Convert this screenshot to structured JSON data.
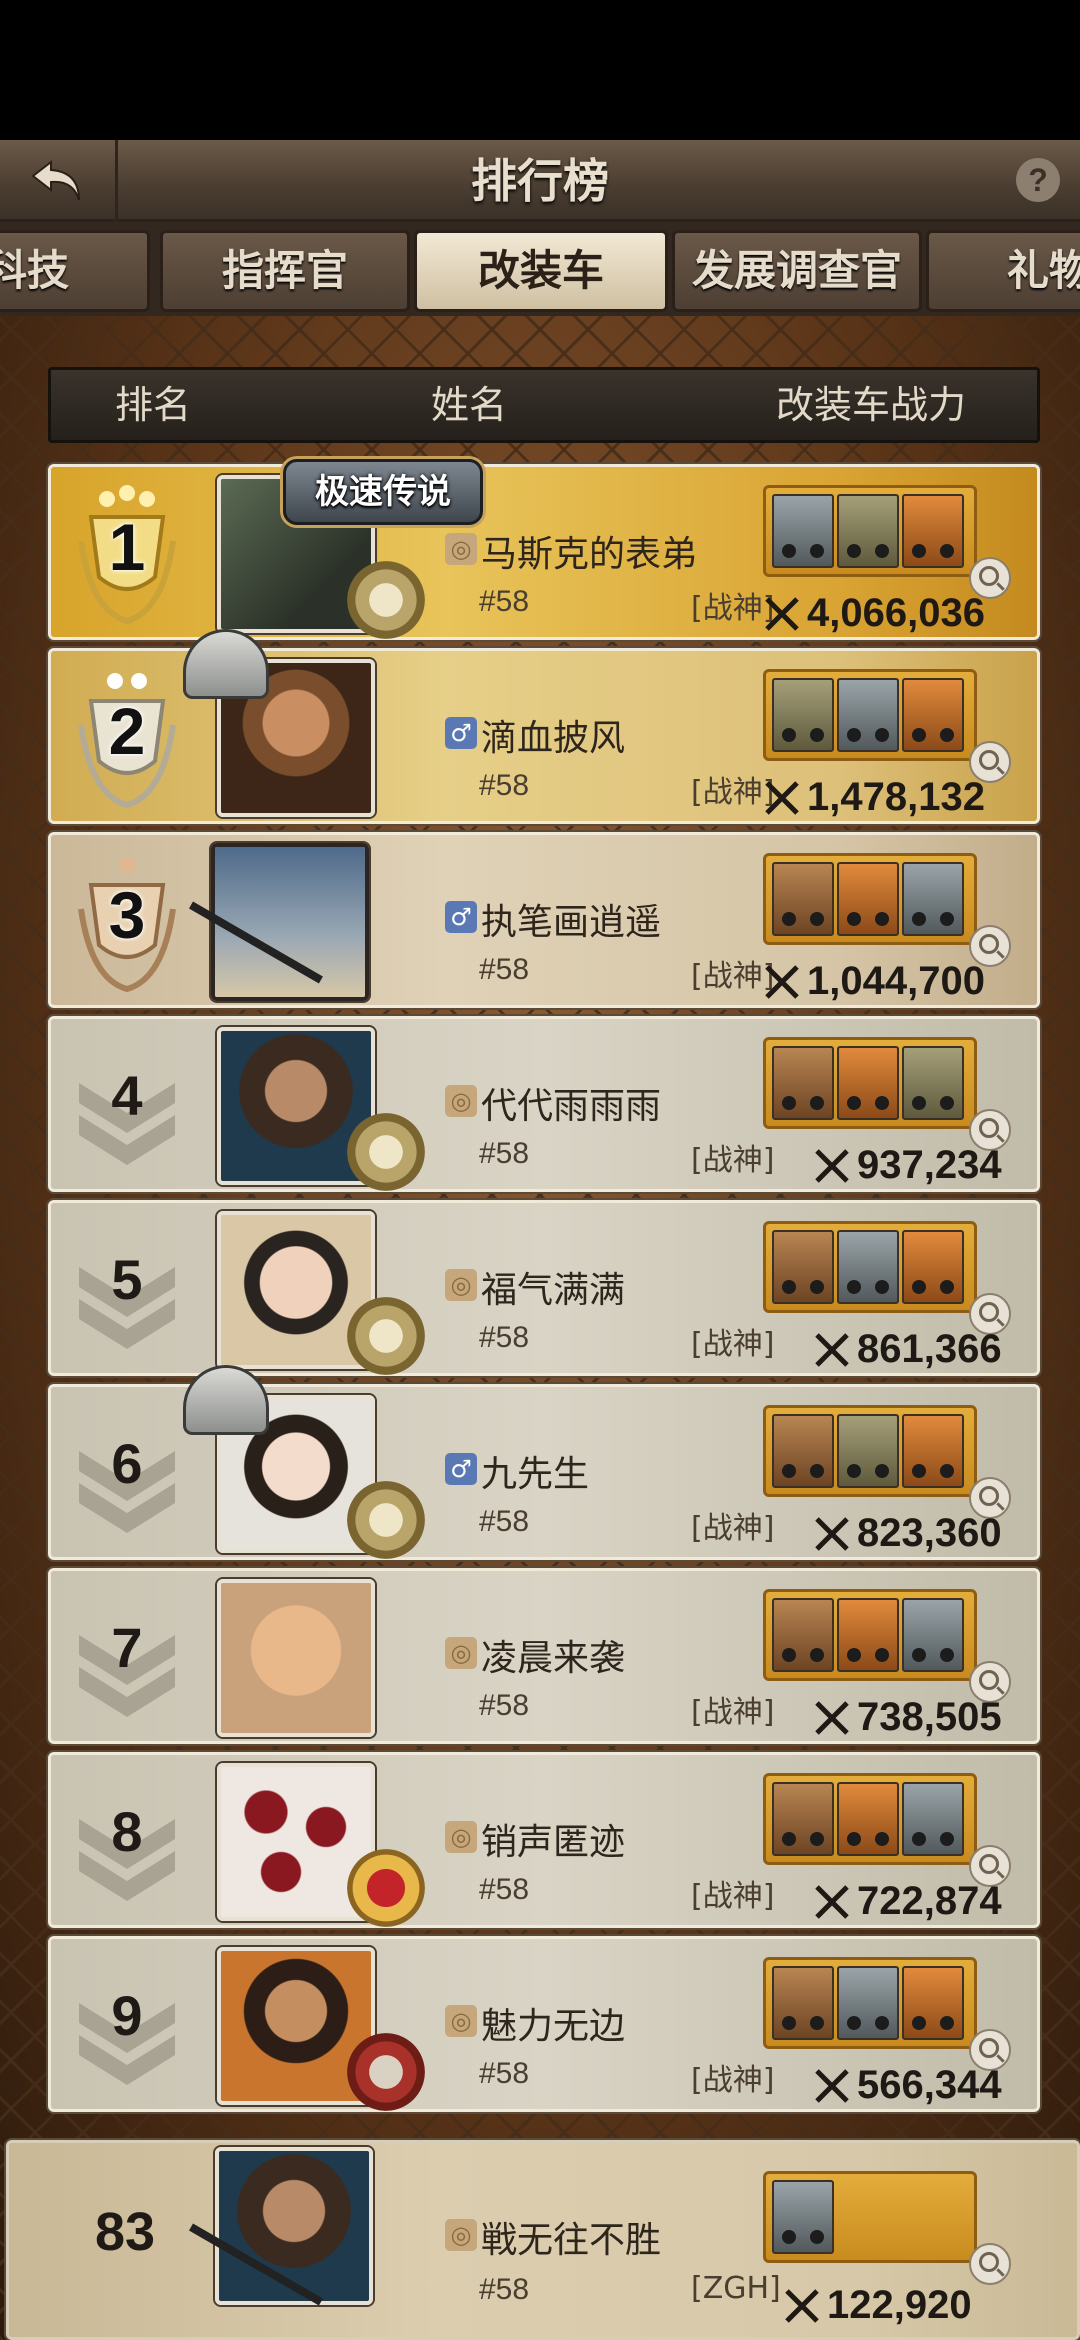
{
  "header": {
    "title": "排行榜",
    "back_label": "",
    "help_label": "?"
  },
  "tabs": [
    {
      "label": "科技",
      "active": false
    },
    {
      "label": "指挥官",
      "active": false
    },
    {
      "label": "改装车",
      "active": true
    },
    {
      "label": "发展调查官",
      "active": false
    },
    {
      "label": "礼物",
      "active": false
    }
  ],
  "columns": {
    "rank": "排名",
    "name": "姓名",
    "power": "改装车战力"
  },
  "rows": [
    {
      "rank": "1",
      "name": "马斯克的表弟",
      "server": "#58",
      "alliance": "[战神]",
      "power": "4,066,036",
      "gender": "hidden",
      "banner": "极速传说"
    },
    {
      "rank": "2",
      "name": "滴血披风",
      "server": "#58",
      "alliance": "[战神]",
      "power": "1,478,132",
      "gender": "male"
    },
    {
      "rank": "3",
      "name": "执笔画逍遥",
      "server": "#58",
      "alliance": "[战神]",
      "power": "1,044,700",
      "gender": "male"
    },
    {
      "rank": "4",
      "name": "代代雨雨雨",
      "server": "#58",
      "alliance": "[战神]",
      "power": "937,234",
      "gender": "hidden"
    },
    {
      "rank": "5",
      "name": "福气满满",
      "server": "#58",
      "alliance": "[战神]",
      "power": "861,366",
      "gender": "hidden"
    },
    {
      "rank": "6",
      "name": "九先生",
      "server": "#58",
      "alliance": "[战神]",
      "power": "823,360",
      "gender": "male"
    },
    {
      "rank": "7",
      "name": "凌晨来袭",
      "server": "#58",
      "alliance": "[战神]",
      "power": "738,505",
      "gender": "hidden"
    },
    {
      "rank": "8",
      "name": "销声匿迹",
      "server": "#58",
      "alliance": "[战神]",
      "power": "722,874",
      "gender": "hidden"
    },
    {
      "rank": "9",
      "name": "魅力无边",
      "server": "#58",
      "alliance": "[战神]",
      "power": "566,344",
      "gender": "hidden"
    }
  ],
  "self_row": {
    "rank": "83",
    "name": "戦无往不胜",
    "server": "#58",
    "alliance": "[ZGH]",
    "power": "122,920",
    "gender": "hidden"
  },
  "colors": {
    "gold": "#d9a433",
    "accent_brown": "#4a3d31",
    "male_icon": "#5a79b4"
  }
}
